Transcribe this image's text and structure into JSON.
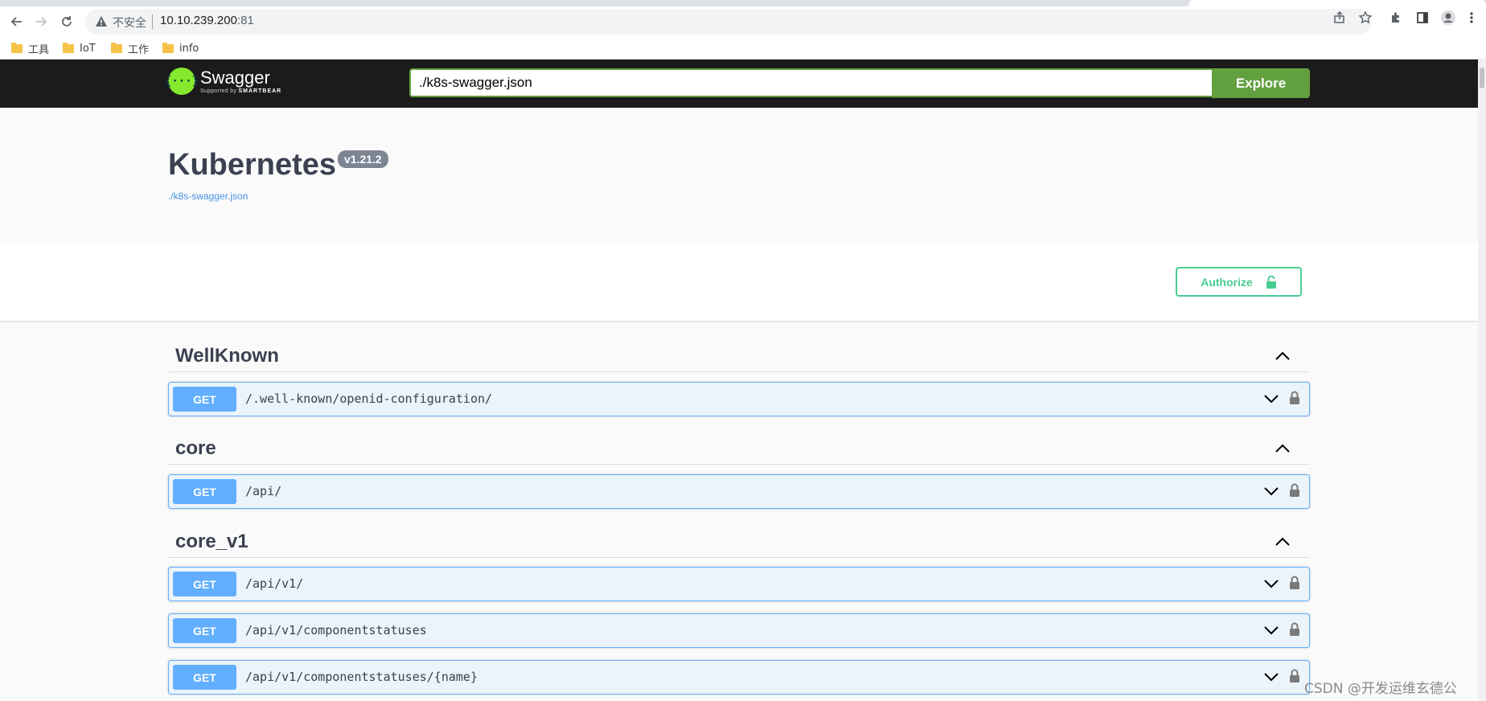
{
  "browser": {
    "security_label": "不安全",
    "url_host": "10.10.239.200",
    "url_port": ":81",
    "bookmarks": [
      "工具",
      "IoT",
      "工作",
      "info"
    ]
  },
  "topbar": {
    "logo_title": "Swagger",
    "logo_supported": "Supported by",
    "logo_brand": "SMARTBEAR",
    "url_value": "./k8s-swagger.json",
    "explore_label": "Explore"
  },
  "info": {
    "title": "Kubernetes",
    "version": "v1.21.2",
    "spec_link": "./k8s-swagger.json"
  },
  "auth": {
    "authorize_label": "Authorize"
  },
  "tags": [
    {
      "name": "WellKnown",
      "ops": [
        {
          "method": "GET",
          "path": "/.well-known/openid-configuration/"
        }
      ]
    },
    {
      "name": "core",
      "ops": [
        {
          "method": "GET",
          "path": "/api/"
        }
      ]
    },
    {
      "name": "core_v1",
      "ops": [
        {
          "method": "GET",
          "path": "/api/v1/"
        },
        {
          "method": "GET",
          "path": "/api/v1/componentstatuses"
        },
        {
          "method": "GET",
          "path": "/api/v1/componentstatuses/{name}"
        }
      ]
    }
  ],
  "watermark": "CSDN @开发运维玄德公",
  "colors": {
    "get": "#61affe",
    "get_bg": "#ebf3fb",
    "explore": "#62a03f",
    "authorize": "#49cc90",
    "topbar": "#1b1b1b"
  }
}
